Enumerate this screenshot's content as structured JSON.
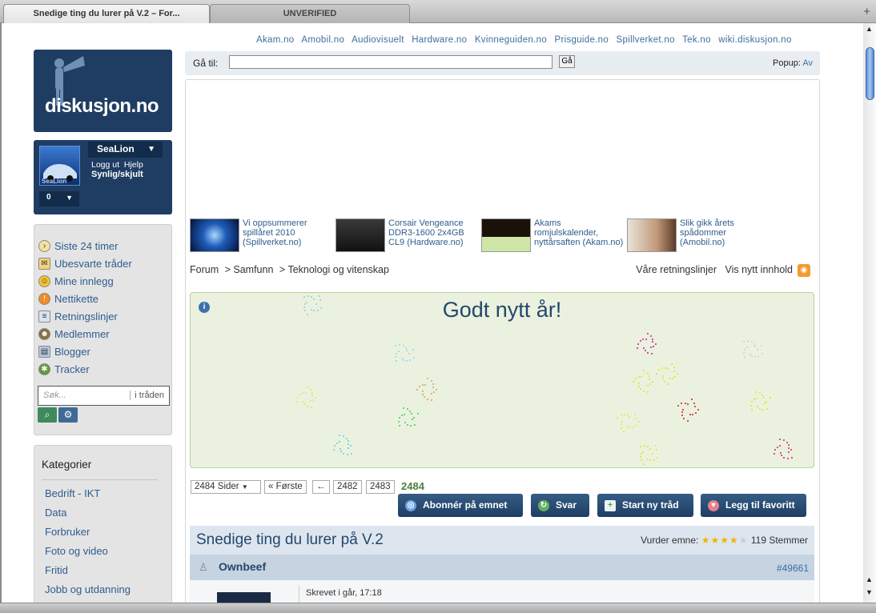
{
  "browser": {
    "active_tab": "Snedige ting du lurer på V.2 – For...",
    "inactive_tab": "UNVERIFIED",
    "new_tab": "+"
  },
  "top_links": [
    "Akam.no",
    "Amobil.no",
    "Audiovisuelt",
    "Hardware.no",
    "Kvinneguiden.no",
    "Prisguide.no",
    "Spillverket.no",
    "Tek.no",
    "wiki.diskusjon.no"
  ],
  "logo": {
    "text": "diskusjon.no"
  },
  "user": {
    "name": "SeaLion",
    "avatar_caption": "SeaLion",
    "logout": "Logg ut",
    "help": "Hjelp",
    "visibility": "Synlig/skjult",
    "count": "0"
  },
  "nav": [
    {
      "label": "Siste 24 timer",
      "icon": "clock-icon"
    },
    {
      "label": "Ubesvarte tråder",
      "icon": "mail-icon"
    },
    {
      "label": "Mine innlegg",
      "icon": "smiley-icon"
    },
    {
      "label": "Nettikette",
      "icon": "warning-icon"
    },
    {
      "label": "Retningslinjer",
      "icon": "document-icon"
    },
    {
      "label": "Medlemmer",
      "icon": "people-icon"
    },
    {
      "label": "Blogger",
      "icon": "blog-icon"
    },
    {
      "label": "Tracker",
      "icon": "bug-icon"
    }
  ],
  "search": {
    "placeholder": "Søk...",
    "scope": "i tråden"
  },
  "categories": {
    "title": "Kategorier",
    "items": [
      "Bedrift - IKT",
      "Data",
      "Forbruker",
      "Foto og video",
      "Fritid",
      "Jobb og utdanning"
    ]
  },
  "goto": {
    "label": "Gå til:",
    "button": "Gå",
    "popup_label": "Popup:",
    "popup_value": "Av"
  },
  "ads": [
    {
      "text": "Vi oppsummerer spillåret 2010 (Spillverket.no)"
    },
    {
      "text": "Corsair Vengeance DDR3-1600 2x4GB CL9 (Hardware.no)"
    },
    {
      "text": "Akams romjulskalender, nyttårsaften (Akam.no)"
    },
    {
      "text": "Slik gikk årets spådommer (Amobil.no)"
    }
  ],
  "breadcrumb": [
    "Forum",
    "> Samfunn",
    "> Teknologi og vitenskap"
  ],
  "right_nav": {
    "guidelines": "Våre retningslinjer",
    "new_content": "Vis nytt innhold"
  },
  "banner": {
    "title": "Godt nytt år!"
  },
  "pager": {
    "pages": "2484 Sider",
    "first": "« Første",
    "prev": "←",
    "p1": "2482",
    "p2": "2483",
    "current": "2484"
  },
  "actions": {
    "subscribe": "Abonnér på emnet",
    "reply": "Svar",
    "new_thread": "Start ny tråd",
    "favorite": "Legg til favoritt"
  },
  "thread": {
    "title": "Snedige ting du lurer på V.2",
    "rate_label": "Vurder emne:",
    "stars": 4,
    "votes": "119 Stemmer"
  },
  "post": {
    "author": "Ownbeef",
    "number": "#49661",
    "meta": "Skrevet i går, 17:18"
  },
  "colors": {
    "brand": "#1f3d63",
    "link": "#2f5c8f",
    "banner_bg": "#eaf2df",
    "current_page": "#4b7f3f"
  }
}
